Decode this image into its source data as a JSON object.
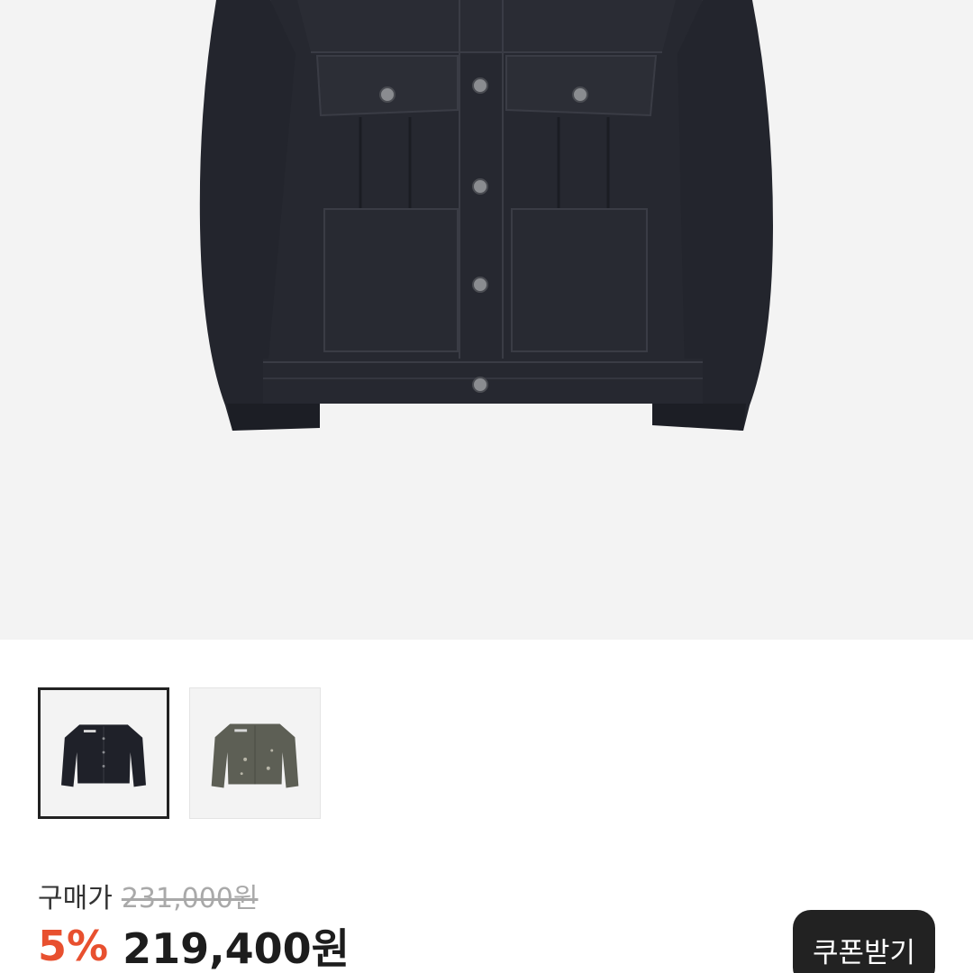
{
  "product": {
    "image_alt": "black distressed trucker jacket",
    "thumbnails": [
      {
        "name": "black",
        "color": "#1f2129",
        "selected": true
      },
      {
        "name": "khaki",
        "color": "#5d5f55",
        "selected": false
      }
    ]
  },
  "pricing": {
    "label": "구매가",
    "original_price": "231,000원",
    "discount_rate": "5%",
    "sale_price": "219,400원",
    "discount_color": "#e8502f"
  },
  "actions": {
    "coupon_label": "쿠폰받기"
  }
}
